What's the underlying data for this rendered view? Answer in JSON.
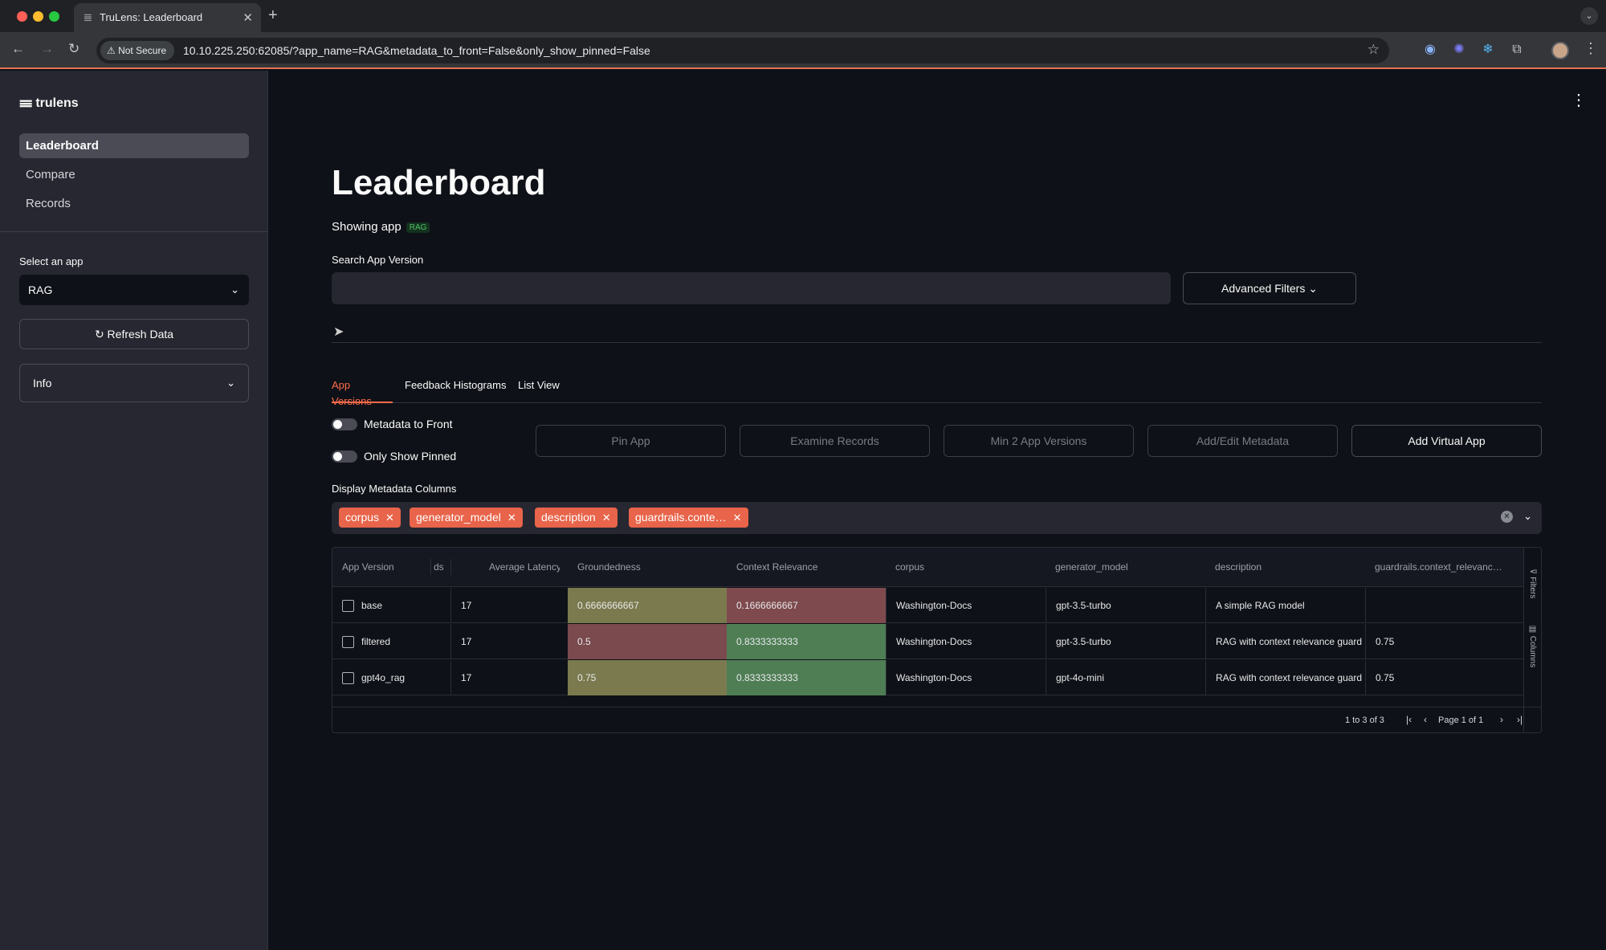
{
  "browser": {
    "tab_title": "TruLens: Leaderboard",
    "security_label": "Not Secure",
    "url": "10.10.225.250:62085/?app_name=RAG&metadata_to_front=False&only_show_pinned=False"
  },
  "sidebar": {
    "logo_text": "trulens",
    "nav": [
      {
        "label": "Leaderboard",
        "active": true
      },
      {
        "label": "Compare",
        "active": false
      },
      {
        "label": "Records",
        "active": false
      }
    ],
    "select_label": "Select an app",
    "selected_app": "RAG",
    "refresh_label": "↻ Refresh Data",
    "info_label": "Info"
  },
  "main": {
    "title": "Leaderboard",
    "showing_prefix": "Showing app",
    "app_badge": "RAG",
    "search_label": "Search App Version",
    "search_placeholder": "",
    "advanced_filters": "Advanced Filters ⌄",
    "tabs": [
      "App Versions",
      "Feedback Histograms",
      "List View"
    ],
    "toggles": [
      {
        "label": "Metadata to Front",
        "on": false
      },
      {
        "label": "Only Show Pinned",
        "on": false
      }
    ],
    "actions": [
      {
        "label": "Pin App",
        "enabled": false
      },
      {
        "label": "Examine Records",
        "enabled": false
      },
      {
        "label": "Min 2 App Versions",
        "enabled": false
      },
      {
        "label": "Add/Edit Metadata",
        "enabled": false
      },
      {
        "label": "Add Virtual App",
        "enabled": true
      }
    ],
    "metadata_label": "Display Metadata Columns",
    "metadata_chips": [
      "corpus",
      "generator_model",
      "description",
      "guardrails.conte…"
    ]
  },
  "grid": {
    "columns": [
      "App Version",
      "ds",
      "Average Latency",
      "Groundedness",
      "Context Relevance",
      "corpus",
      "generator_model",
      "description",
      "guardrails.context_relevanc…"
    ],
    "rows": [
      {
        "app_version": "base",
        "records": "17",
        "latency": "",
        "groundedness": "0.6666666667",
        "context_relevance": "0.1666666667",
        "corpus": "Washington-Docs",
        "generator_model": "gpt-3.5-turbo",
        "description": "A simple RAG model",
        "guardrails": ""
      },
      {
        "app_version": "filtered",
        "records": "17",
        "latency": "",
        "groundedness": "0.5",
        "context_relevance": "0.8333333333",
        "corpus": "Washington-Docs",
        "generator_model": "gpt-3.5-turbo",
        "description": "RAG with context relevance guard",
        "guardrails": "0.75"
      },
      {
        "app_version": "gpt4o_rag",
        "records": "17",
        "latency": "",
        "groundedness": "0.75",
        "context_relevance": "0.8333333333",
        "corpus": "Washington-Docs",
        "generator_model": "gpt-4o-mini",
        "description": "RAG with context relevance guard",
        "guardrails": "0.75"
      }
    ],
    "cell_colors": {
      "groundedness": [
        "#7a7a4e",
        "#7a4a4e",
        "#7a7a4e"
      ],
      "context_relevance": [
        "#7e4a4e",
        "#4f7e55",
        "#4f7e55"
      ]
    },
    "side_filters": "Filters",
    "side_columns": "Columns",
    "footer_count": "1 to 3 of 3",
    "footer_page": "Page 1 of 1"
  }
}
